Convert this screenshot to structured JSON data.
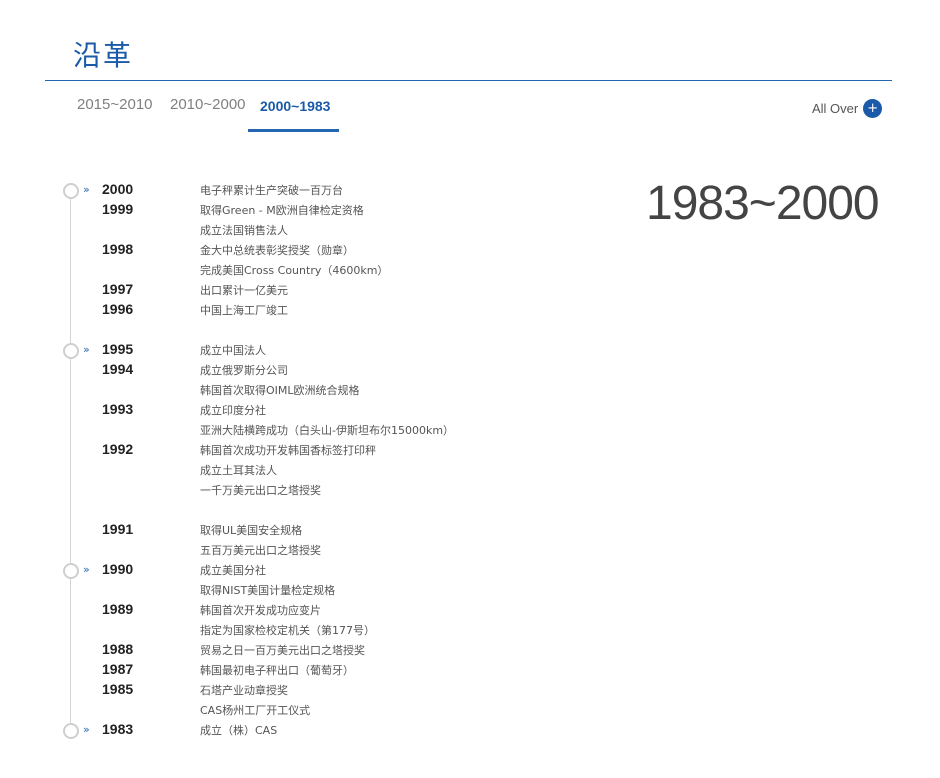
{
  "page": {
    "title": "沿革"
  },
  "tabs": [
    {
      "label": "2015~2010"
    },
    {
      "label": "2010~2000"
    },
    {
      "label": "2000~1983"
    }
  ],
  "all_over": {
    "label": "All Over",
    "icon": "plus-circle-icon"
  },
  "range_heading": "1983~2000",
  "years": {
    "y2000": "2000",
    "y1999": "1999",
    "y1998": "1998",
    "y1997": "1997",
    "y1996": "1996",
    "y1995": "1995",
    "y1994": "1994",
    "y1993": "1993",
    "y1992": "1992",
    "y1991": "1991",
    "y1990": "1990",
    "y1989": "1989",
    "y1988": "1988",
    "y1987": "1987",
    "y1985": "1985",
    "y1983": "1983"
  },
  "events": [
    "电子秤累计生产突破一百万台",
    "取得Green - M欧洲自律检定资格",
    "成立法国销售法人",
    "金大中总统表彰奖授奖（勋章）",
    "完成美国Cross Country（4600km）",
    "出口累计一亿美元",
    "中国上海工厂竣工",
    "成立中国法人",
    "成立俄罗斯分公司",
    "韩国首次取得OIML欧洲统合规格",
    "成立印度分社",
    "亚洲大陆横跨成功（白头山-伊斯坦布尔15000km）",
    "韩国首次成功开发韩国香标签打印秤",
    "成立土耳其法人",
    "一千万美元出口之塔授奖",
    "取得UL美国安全规格",
    "五百万美元出口之塔授奖",
    "成立美国分社",
    "取得NIST美国计量检定规格",
    "韩国首次开发成功应变片",
    "指定为国家检校定机关（第177号）",
    "贸易之日一百万美元出口之塔授奖",
    "韩国最初电子秤出口（葡萄牙）",
    "石塔产业动章授奖",
    "CAS杨州工厂开工仪式",
    "成立（株）CAS"
  ],
  "colors": {
    "accent": "#1a5aa8",
    "rule": "#2466b0",
    "text": "#333333"
  }
}
